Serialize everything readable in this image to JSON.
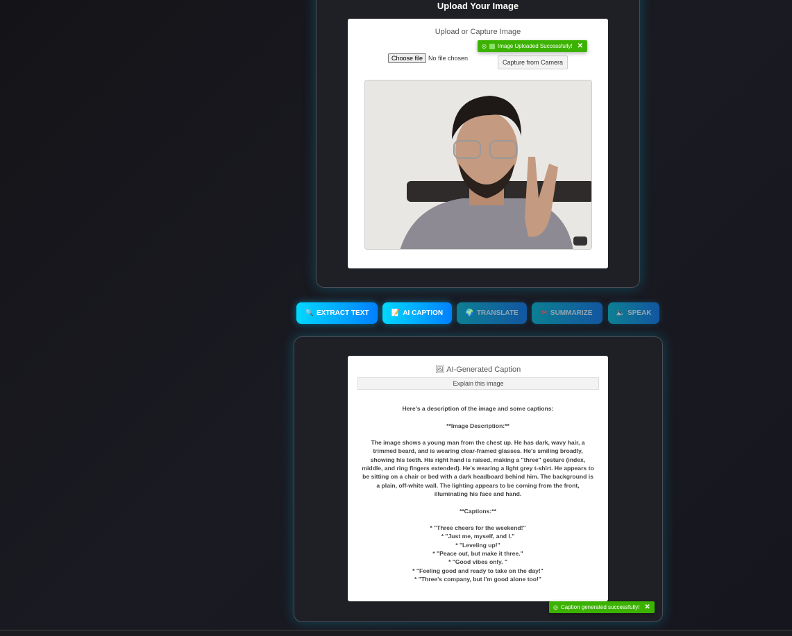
{
  "upload_panel": {
    "title": "Upload Your Image",
    "card_title": "Upload or Capture Image",
    "choose_file": "Choose file",
    "no_file": "No file chosen",
    "capture_button": "Capture from Camera",
    "toast": "Image Uploaded Successfully!",
    "toast_close": "✕"
  },
  "actions": [
    {
      "icon": "🔍",
      "label": "EXTRACT TEXT",
      "active": true
    },
    {
      "icon": "📝",
      "label": "AI CAPTION",
      "active": true
    },
    {
      "icon": "🌍",
      "label": "TRANSLATE",
      "active": false
    },
    {
      "icon": "✂",
      "label": "SUMMARIZE",
      "active": false
    },
    {
      "icon": "🔈",
      "label": "SPEAK",
      "active": false
    }
  ],
  "result_panel": {
    "icon": "🖼",
    "title": "AI-Generated Caption",
    "explain_button": "Explain this image",
    "intro": "Here's a description of the image and some captions:",
    "desc_heading": "**Image Description:**",
    "description": "The image shows a young man from the chest up. He has dark, wavy hair, a trimmed beard, and is wearing clear-framed glasses. He's smiling broadly, showing his teeth. His right hand is raised, making a \"three\" gesture (index, middle, and ring fingers extended). He's wearing a light grey t-shirt. He appears to be sitting on a chair or bed with a dark headboard behind him. The background is a plain, off-white wall. The lighting appears to be coming from the front, illuminating his face and hand.",
    "captions_heading": "**Captions:**",
    "captions": [
      "*   \"Three cheers for the weekend!\"",
      "*   \"Just me, myself, and I.\"",
      "*   \"Leveling up!\"",
      "*   \"Peace out, but make it three.\"",
      "*   \"Good vibes only. \"",
      "*   \"Feeling good and ready to take on the day!\"",
      "*   \"Three's company, but I'm good alone too!\""
    ],
    "toast": "Caption generated successfully!",
    "toast_close": "✕"
  },
  "colors": {
    "accent": "#00d8ff",
    "success": "#3cb200"
  }
}
